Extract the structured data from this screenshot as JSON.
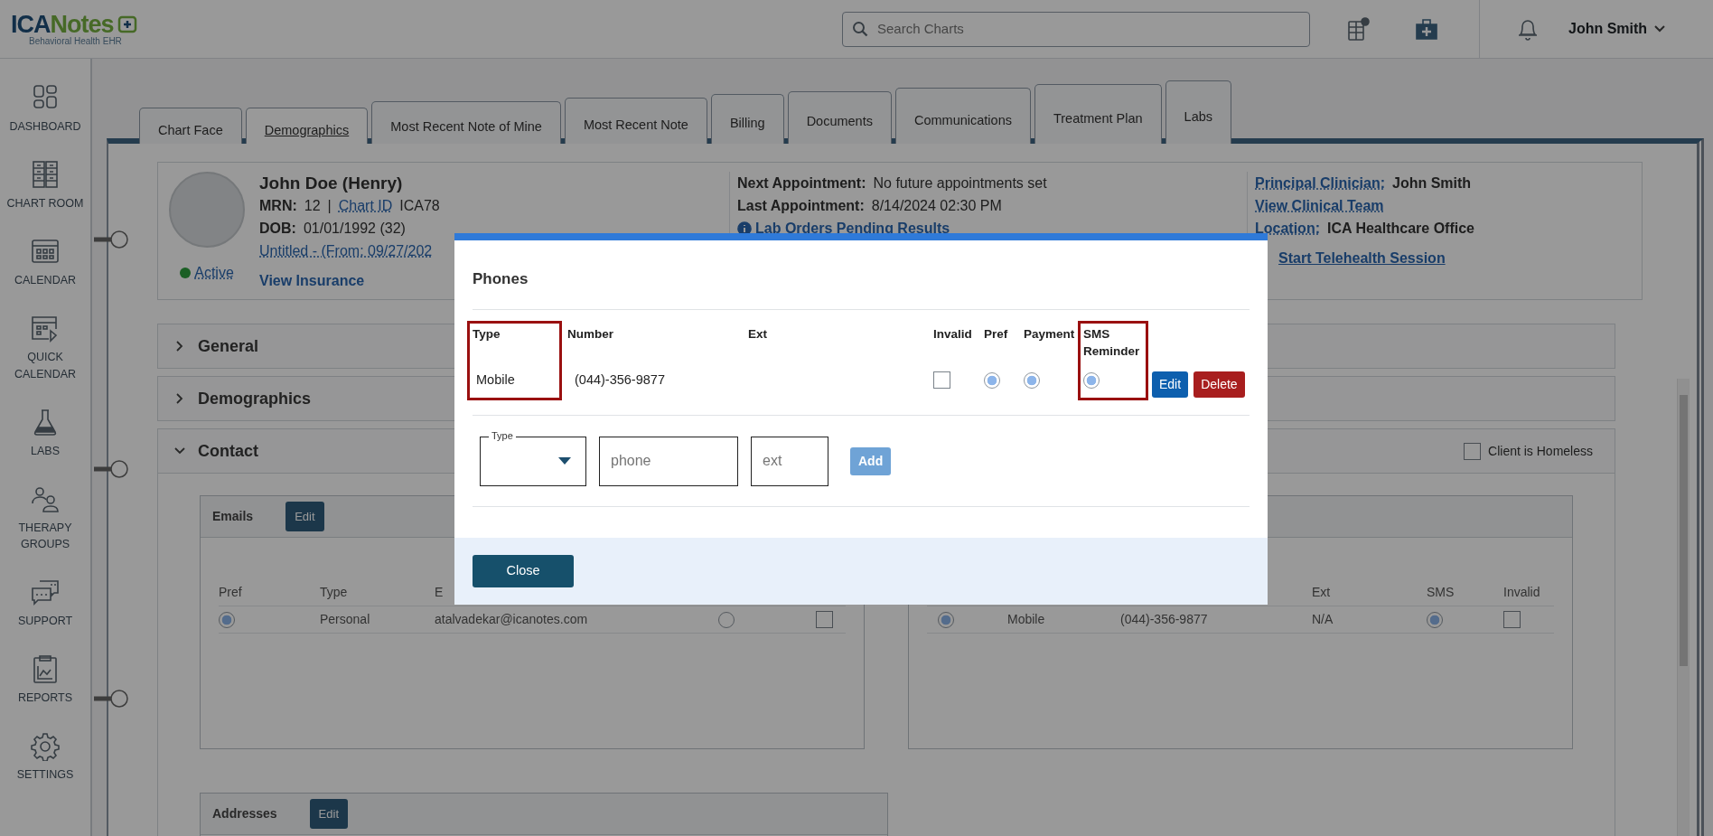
{
  "header": {
    "logo": {
      "part_1": "ICA",
      "part_2": "Notes",
      "subtitle": "Behavioral Health EHR"
    },
    "search": {
      "placeholder": "Search Charts"
    },
    "user": "John Smith"
  },
  "sidebar": {
    "items": [
      {
        "label": "DASHBOARD"
      },
      {
        "label": "CHART ROOM"
      },
      {
        "label": "CALENDAR"
      },
      {
        "label": "QUICK CALENDAR"
      },
      {
        "label": "LABS"
      },
      {
        "label": "THERAPY GROUPS"
      },
      {
        "label": "SUPPORT"
      },
      {
        "label": "REPORTS"
      },
      {
        "label": "SETTINGS"
      }
    ]
  },
  "tabs": [
    {
      "label": "Chart Face",
      "selected": false
    },
    {
      "label": "Demographics",
      "selected": true
    },
    {
      "label": "Most Recent Note of Mine",
      "selected": false
    },
    {
      "label": "Most Recent Note",
      "selected": false
    },
    {
      "label": "Billing",
      "selected": false
    },
    {
      "label": "Documents",
      "selected": false
    },
    {
      "label": "Communications",
      "selected": false
    },
    {
      "label": "Treatment Plan",
      "selected": false
    },
    {
      "label": "Labs",
      "selected": false
    }
  ],
  "patient": {
    "name": "John Doe (Henry)",
    "mrn_label": "MRN:",
    "mrn": "12",
    "separator": "|",
    "chart_id_label": "Chart ID",
    "chart_id": "ICA78",
    "dob_label": "DOB:",
    "dob": "01/01/1992 (32)",
    "episode": "Untitled - (From: 09/27/202",
    "status": "Active",
    "insurance": "View Insurance",
    "next_appointment_label": "Next Appointment:",
    "next_appointment": "No future appointments set",
    "last_appointment_label": "Last Appointment:",
    "last_appointment": "8/14/2024 02:30 PM",
    "lab_orders": "Lab Orders Pending Results",
    "clinician_label": "Principal Clinician:",
    "clinician": "John Smith",
    "clinical_team": "View Clinical Team",
    "location_label": "Location:",
    "location": "ICA Healthcare Office",
    "telehealth": "Start Telehealth Session"
  },
  "sections": [
    {
      "title": "General",
      "expanded": false
    },
    {
      "title": "Demographics",
      "expanded": false
    },
    {
      "title": "Contact",
      "expanded": true
    }
  ],
  "homeless": {
    "label": "Client is Homeless",
    "checked": false
  },
  "emails": {
    "title": "Emails",
    "edit": "Edit",
    "columns": [
      "Pref",
      "Type",
      "E"
    ],
    "rows": [
      {
        "pref": true,
        "type": "Personal",
        "email": "atalvadekar@icanotes.com",
        "column_4": false,
        "column_5": false
      }
    ]
  },
  "phones": {
    "columns": [
      "Ext",
      "SMS",
      "Invalid"
    ],
    "rows": [
      {
        "pref": true,
        "type": "Mobile",
        "number": "(044)-356-9877",
        "ext": "N/A",
        "sms": true,
        "invalid": false
      }
    ]
  },
  "addresses": {
    "title": "Addresses",
    "edit": "Edit"
  },
  "modal": {
    "title": "Phones",
    "columns": [
      {
        "label": "Type",
        "highlighted": true
      },
      {
        "label": "Number",
        "highlighted": false
      },
      {
        "label": "Ext",
        "highlighted": false
      },
      {
        "label": "Invalid",
        "highlighted": false
      },
      {
        "label": "Pref",
        "highlighted": false
      },
      {
        "label": "Payment",
        "highlighted": false
      },
      {
        "label": "SMS Reminder",
        "highlighted": true
      }
    ],
    "rows": [
      {
        "type": "Mobile",
        "number": "(044)-356-9877",
        "invalid": false,
        "pref": true,
        "payment": true,
        "sms_reminder": true,
        "edit": "Edit",
        "delete": "Delete"
      }
    ],
    "form": {
      "type_label": "Type",
      "phone_placeholder": "phone",
      "ext_placeholder": "ext",
      "add": "Add"
    },
    "close": "Close"
  }
}
